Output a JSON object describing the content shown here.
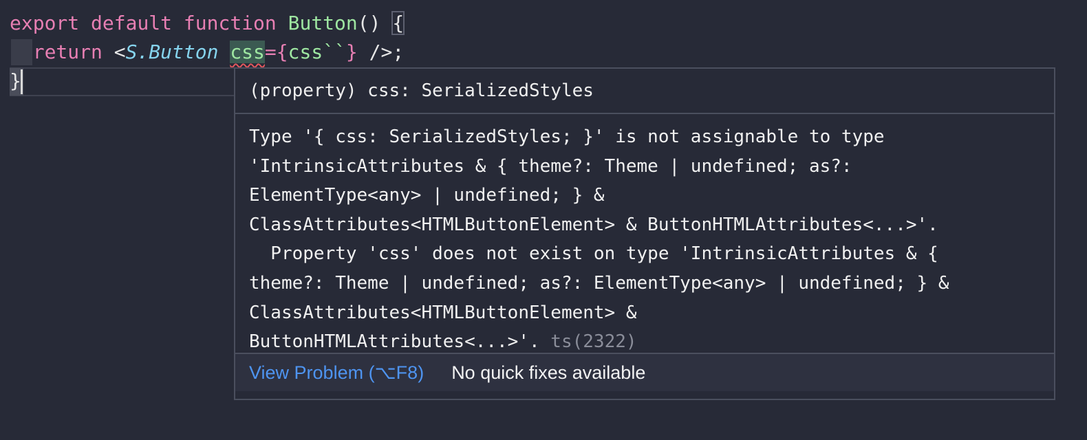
{
  "editor": {
    "line1": {
      "export": "export",
      "default": "default",
      "function": "function",
      "name": "Button",
      "parens": "()",
      "space": " ",
      "open_brace": "{"
    },
    "line2": {
      "return": "return",
      "lt": "<",
      "component": "S.Button",
      "attr": "css",
      "eq": "=",
      "lbrace": "{",
      "tag": "css",
      "backticks": "``",
      "rbrace": "}",
      "close": "/>;"
    },
    "line3": {
      "close_brace": "}"
    }
  },
  "hover": {
    "signature": "(property) css: SerializedStyles",
    "message_lines": [
      "Type '{ css: SerializedStyles; }' is not assignable to type",
      "'IntrinsicAttributes & { theme?: Theme | undefined; as?:",
      "ElementType<any> | undefined; } &",
      "ClassAttributes<HTMLButtonElement> & ButtonHTMLAttributes<...>'.",
      "  Property 'css' does not exist on type 'IntrinsicAttributes & {",
      "theme?: Theme | undefined; as?: ElementType<any> | undefined; } &",
      "ClassAttributes<HTMLButtonElement> &",
      "ButtonHTMLAttributes<...>'. "
    ],
    "error_code": "ts(2322)",
    "view_problem": "View Problem (⌥F8)",
    "no_quick_fixes": "No quick fixes available"
  }
}
